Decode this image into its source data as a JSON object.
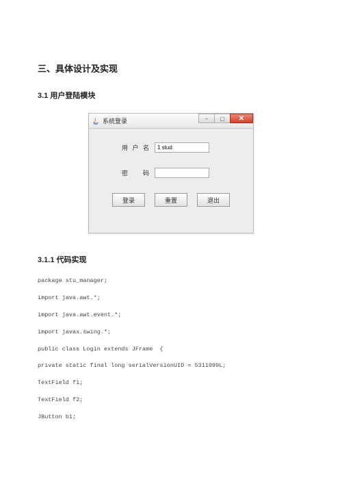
{
  "headings": {
    "h1": "三、具体设计及实现",
    "h2_1": "3.1 用户登陆模块",
    "h2_2": "3.1.1 代码实现"
  },
  "dialog": {
    "title": "系统登录",
    "labels": {
      "username": "用户名",
      "password": "密  码"
    },
    "values": {
      "username": "1 stud"
    },
    "buttons": {
      "login": "登录",
      "reset": "重置",
      "exit": "退出"
    },
    "win_controls": {
      "min": "–",
      "max": "▢",
      "close": "✕"
    }
  },
  "code": {
    "l1": "package stu_manager;",
    "l2": "import java.awt.*;",
    "l3": "import java.awt.event.*;",
    "l4": "import javax.swing.*;",
    "l5": "public class Login extends JFrame  {",
    "l6": "private static final long serialVersionUID = 5311099L;",
    "l7": "TextField f1;",
    "l8": "TextField f2;",
    "l9": "JButton b1;"
  }
}
